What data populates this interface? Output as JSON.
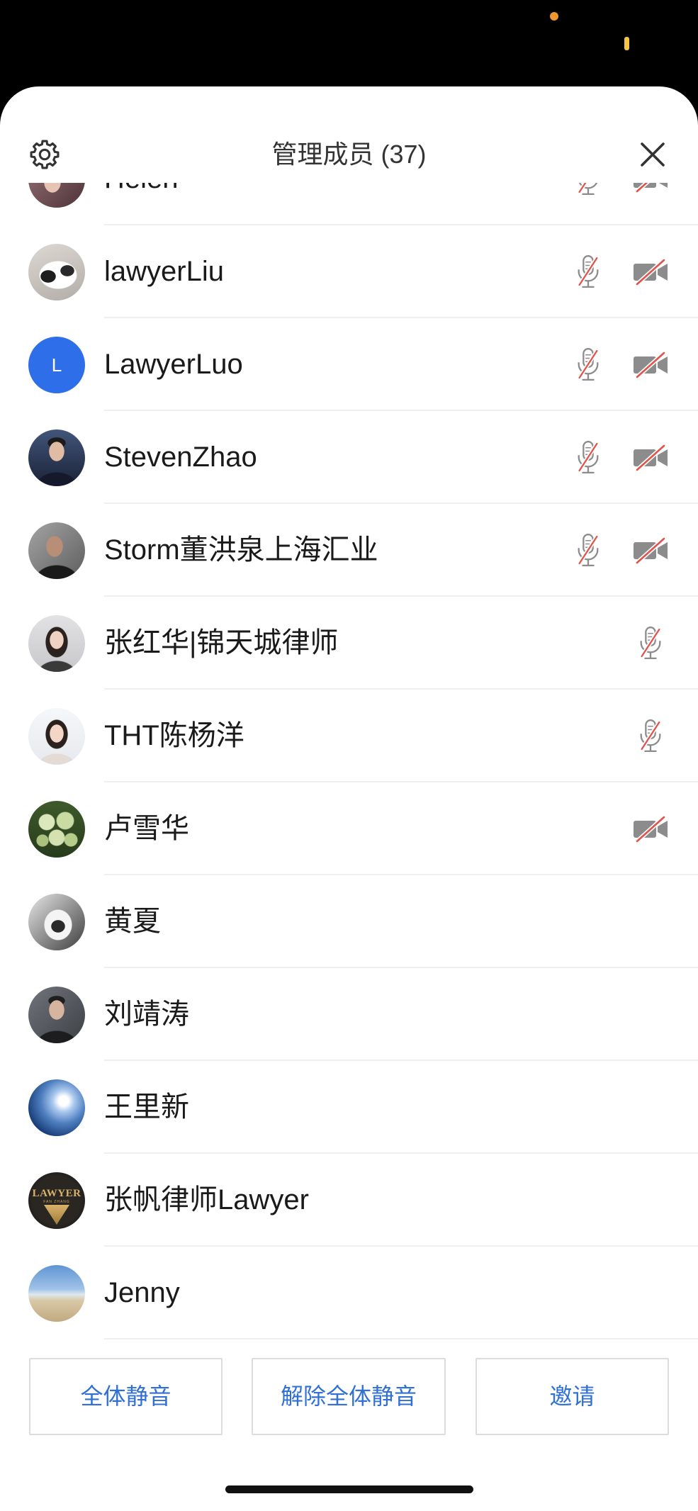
{
  "header": {
    "title": "管理成员 (37)",
    "settings_icon": "gear-icon",
    "close_icon": "close-icon"
  },
  "members": [
    {
      "name": "Helen",
      "mic_muted": true,
      "camera_off": true
    },
    {
      "name": "lawyerLiu",
      "mic_muted": true,
      "camera_off": true
    },
    {
      "name": "LawyerLuo",
      "avatar_letter": "L",
      "mic_muted": true,
      "camera_off": true
    },
    {
      "name": "StevenZhao",
      "mic_muted": true,
      "camera_off": true
    },
    {
      "name": "Storm董洪泉上海汇业",
      "mic_muted": true,
      "camera_off": true
    },
    {
      "name": "张红华|锦天城律师",
      "mic_muted": true,
      "camera_off": false
    },
    {
      "name": "THT陈杨洋",
      "mic_muted": true,
      "camera_off": false
    },
    {
      "name": "卢雪华",
      "mic_muted": false,
      "camera_off": true
    },
    {
      "name": "黄夏",
      "mic_muted": false,
      "camera_off": false
    },
    {
      "name": "刘靖涛",
      "mic_muted": false,
      "camera_off": false
    },
    {
      "name": "王里新",
      "mic_muted": false,
      "camera_off": false
    },
    {
      "name": "张帆律师Lawyer",
      "avatar_logo_text": "LAWYER",
      "avatar_logo_subtext": "FAN ZHANG",
      "mic_muted": false,
      "camera_off": false
    },
    {
      "name": "Jenny",
      "mic_muted": false,
      "camera_off": false
    }
  ],
  "icons": {
    "mic_muted": "mic-muted-icon",
    "camera_off": "camera-off-icon"
  },
  "actions": {
    "mute_all": "全体静音",
    "unmute_all": "解除全体静音",
    "invite": "邀请"
  },
  "colors": {
    "accent": "#2f6fd6",
    "muted_slash": "#e0544b",
    "icon_gray": "#8c8c8c",
    "avatar_blue": "#2f6ee9",
    "status_dot": "#f0962e",
    "status_bar_indicator": "#f4c542"
  }
}
